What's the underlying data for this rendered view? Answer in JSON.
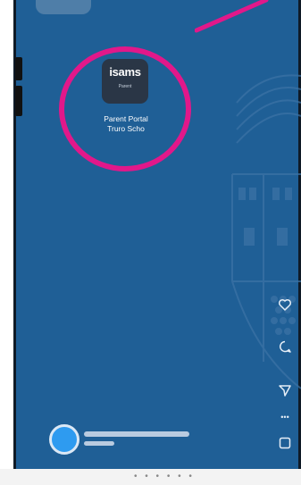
{
  "app": {
    "icon_name": "isams",
    "icon_sub": "Parent",
    "label_line1": "Parent Portal",
    "label_line2": "Truro Scho"
  },
  "colors": {
    "background": "#1f5f96",
    "highlight": "#e1188a",
    "avatar": "#2e9bf0"
  },
  "actions": [
    "heart-icon",
    "comment-icon",
    "send-icon",
    "more-icon",
    "save-icon"
  ],
  "more_glyph": "•••"
}
